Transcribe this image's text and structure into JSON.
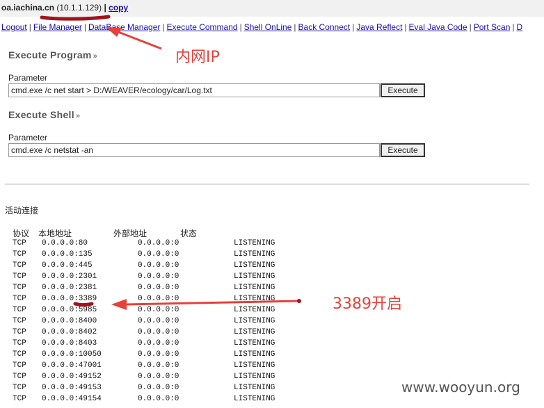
{
  "header": {
    "host": "oa.iachina.cn",
    "ip": "(10.1.1.129)",
    "separator": "|",
    "copy_link": "copy"
  },
  "nav": {
    "items": [
      "Logout",
      "File Manager",
      "DataBase Manager",
      "Execute Command",
      "Shell OnLine",
      "Back Connect",
      "Java Reflect",
      "Eval Java Code",
      "Port Scan",
      "D"
    ]
  },
  "execute_program": {
    "title": "Execute Program",
    "chevron": "»",
    "param_label": "Parameter",
    "value": "cmd.exe /c net start > D:/WEAVER/ecology/car/Log.txt",
    "button_label": "Execute"
  },
  "execute_shell": {
    "title": "Execute Shell",
    "chevron": "»",
    "param_label": "Parameter",
    "value": "cmd.exe /c netstat -an",
    "button_label": "Execute"
  },
  "output": {
    "title": "活动连接",
    "columns": [
      "协议",
      "本地地址",
      "外部地址",
      "状态"
    ],
    "rows": [
      {
        "proto": "TCP",
        "local": "0.0.0.0:80",
        "foreign": "0.0.0.0:0",
        "state": "LISTENING"
      },
      {
        "proto": "TCP",
        "local": "0.0.0.0:135",
        "foreign": "0.0.0.0:0",
        "state": "LISTENING"
      },
      {
        "proto": "TCP",
        "local": "0.0.0.0:445",
        "foreign": "0.0.0.0:0",
        "state": "LISTENING"
      },
      {
        "proto": "TCP",
        "local": "0.0.0.0:2301",
        "foreign": "0.0.0.0:0",
        "state": "LISTENING"
      },
      {
        "proto": "TCP",
        "local": "0.0.0.0:2381",
        "foreign": "0.0.0.0:0",
        "state": "LISTENING"
      },
      {
        "proto": "TCP",
        "local": "0.0.0.0:3389",
        "foreign": "0.0.0.0:0",
        "state": "LISTENING"
      },
      {
        "proto": "TCP",
        "local": "0.0.0.0:5985",
        "foreign": "0.0.0.0:0",
        "state": "LISTENING"
      },
      {
        "proto": "TCP",
        "local": "0.0.0.0:8400",
        "foreign": "0.0.0.0:0",
        "state": "LISTENING"
      },
      {
        "proto": "TCP",
        "local": "0.0.0.0:8402",
        "foreign": "0.0.0.0:0",
        "state": "LISTENING"
      },
      {
        "proto": "TCP",
        "local": "0.0.0.0:8403",
        "foreign": "0.0.0.0:0",
        "state": "LISTENING"
      },
      {
        "proto": "TCP",
        "local": "0.0.0.0:10050",
        "foreign": "0.0.0.0:0",
        "state": "LISTENING"
      },
      {
        "proto": "TCP",
        "local": "0.0.0.0:47001",
        "foreign": "0.0.0.0:0",
        "state": "LISTENING"
      },
      {
        "proto": "TCP",
        "local": "0.0.0.0:49152",
        "foreign": "0.0.0.0:0",
        "state": "LISTENING"
      },
      {
        "proto": "TCP",
        "local": "0.0.0.0:49153",
        "foreign": "0.0.0.0:0",
        "state": "LISTENING"
      },
      {
        "proto": "TCP",
        "local": "0.0.0.0:49154",
        "foreign": "0.0.0.0:0",
        "state": "LISTENING"
      }
    ]
  },
  "annotations": {
    "ip_note": "内网IP",
    "port_note": "3389开启",
    "color": "#e8403a"
  },
  "watermark": "www.wooyun.org"
}
